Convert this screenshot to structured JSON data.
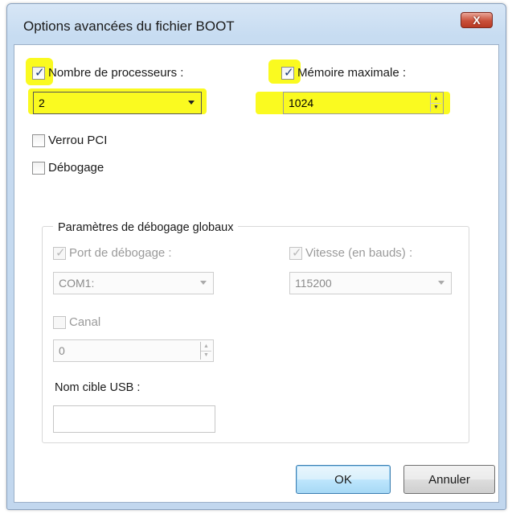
{
  "window": {
    "title": "Options avancées du fichier BOOT",
    "close_label": "X"
  },
  "processors": {
    "label": "Nombre de processeurs :",
    "checked": true,
    "value": "2"
  },
  "memory": {
    "label": "Mémoire maximale :",
    "checked": true,
    "value": "1024"
  },
  "pci_lock": {
    "label": "Verrou PCI",
    "checked": false
  },
  "debugging": {
    "label": "Débogage",
    "checked": false
  },
  "global_debug": {
    "title": "Paramètres de débogage globaux",
    "debug_port": {
      "label": "Port de débogage :",
      "checked": true,
      "value": "COM1:"
    },
    "baud_rate": {
      "label": "Vitesse (en bauds) :",
      "checked": true,
      "value": "115200"
    },
    "channel": {
      "label": "Canal",
      "checked": false,
      "value": "0"
    },
    "usb_target": {
      "label": "Nom cible USB :",
      "value": ""
    }
  },
  "buttons": {
    "ok": "OK",
    "cancel": "Annuler"
  },
  "colors": {
    "highlight": "#fafa20",
    "close_button": "#c9503a",
    "default_button_border": "#3c7fb1"
  }
}
